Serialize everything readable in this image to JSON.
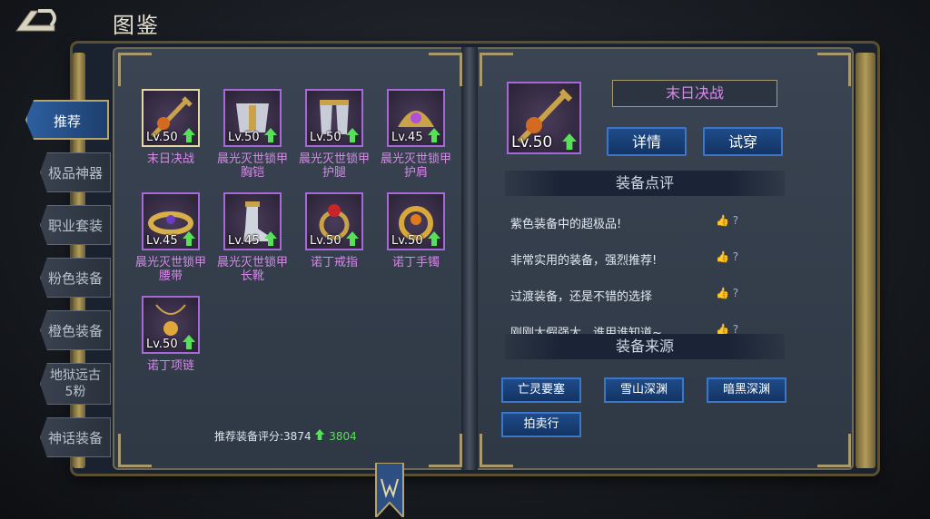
{
  "header": {
    "title": "图鉴"
  },
  "sidebar": {
    "tabs": [
      {
        "label": "推荐",
        "active": true
      },
      {
        "label": "极品神器"
      },
      {
        "label": "职业套装"
      },
      {
        "label": "粉色装备"
      },
      {
        "label": "橙色装备"
      },
      {
        "label": "地狱远古",
        "label2": "5粉"
      },
      {
        "label": "神话装备"
      }
    ]
  },
  "items": [
    {
      "name": "末日决战",
      "level": "Lv.50"
    },
    {
      "name": "晨光灭世锁甲",
      "name2": "胸铠",
      "level": "Lv.50"
    },
    {
      "name": "晨光灭世锁甲",
      "name2": "护腿",
      "level": "Lv.50"
    },
    {
      "name": "晨光灭世锁甲",
      "name2": "护肩",
      "level": "Lv.45"
    },
    {
      "name": "晨光灭世锁甲",
      "name2": "腰带",
      "level": "Lv.45"
    },
    {
      "name": "晨光灭世锁甲",
      "name2": "长靴",
      "level": "Lv.45"
    },
    {
      "name": "诺丁戒指",
      "level": "Lv.50"
    },
    {
      "name": "诺丁手镯",
      "level": "Lv.50"
    },
    {
      "name": "诺丁项链",
      "level": "Lv.50"
    }
  ],
  "score": {
    "label": "推荐装备评分:3874",
    "value": "3804"
  },
  "detail": {
    "name": "末日决战",
    "level": "Lv.50",
    "details_button": "详情",
    "try_button": "试穿",
    "review_title": "装备点评",
    "comments": [
      {
        "text": "紫色装备中的超极品!",
        "likes": "?"
      },
      {
        "text": "非常实用的装备，强烈推荐!",
        "likes": "?"
      },
      {
        "text": "过渡装备，还是不错的选择",
        "likes": "?"
      },
      {
        "text": "刚刚太假强大，谁用谁知道~",
        "likes": "?"
      }
    ],
    "source_title": "装备来源",
    "sources": [
      "亡灵要塞",
      "雪山深渊",
      "暗黑深渊",
      "拍卖行"
    ]
  },
  "colors": {
    "purple_name": "#d58ae8",
    "green_up": "#58e05a",
    "accent_blue": "#1e4b8a"
  }
}
